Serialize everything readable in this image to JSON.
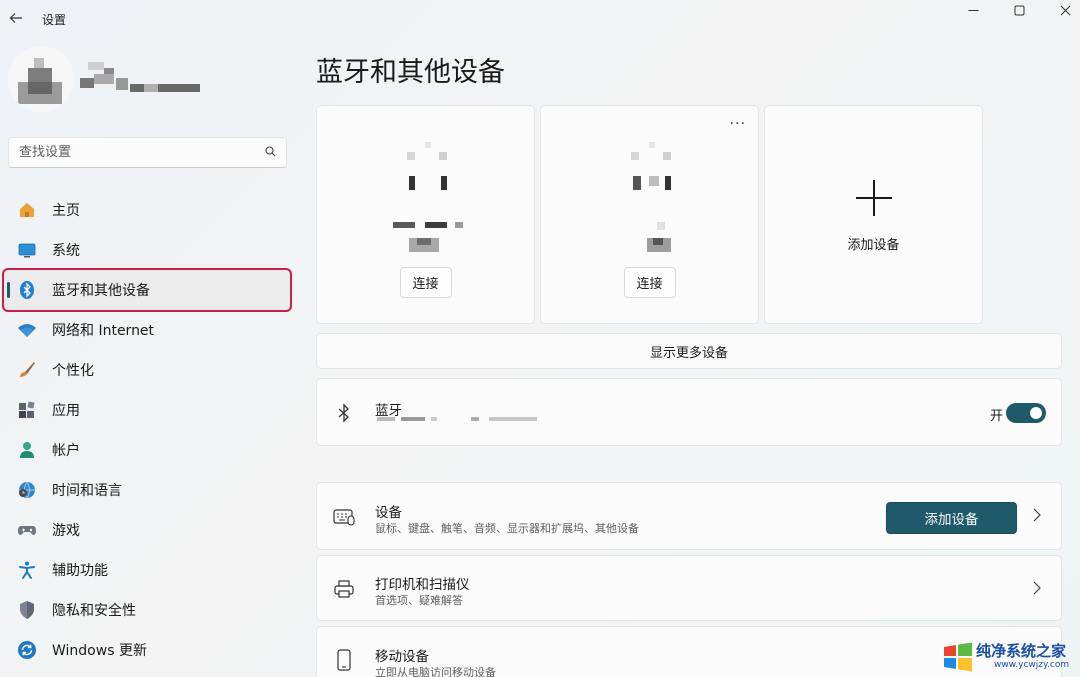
{
  "window": {
    "title": "设置",
    "back_icon": "arrow-left-icon",
    "controls": [
      "minimize-icon",
      "maximize-icon",
      "close-icon"
    ]
  },
  "search": {
    "placeholder": "查找设置",
    "icon": "search-icon"
  },
  "sidebar": {
    "items": [
      {
        "label": "主页",
        "icon": "home-icon",
        "active": false
      },
      {
        "label": "系统",
        "icon": "system-icon",
        "active": false
      },
      {
        "label": "蓝牙和其他设备",
        "icon": "bluetooth-icon",
        "active": true
      },
      {
        "label": "网络和 Internet",
        "icon": "wifi-icon",
        "active": false
      },
      {
        "label": "个性化",
        "icon": "brush-icon",
        "active": false
      },
      {
        "label": "应用",
        "icon": "apps-icon",
        "active": false
      },
      {
        "label": "帐户",
        "icon": "account-icon",
        "active": false
      },
      {
        "label": "时间和语言",
        "icon": "globe-clock-icon",
        "active": false
      },
      {
        "label": "游戏",
        "icon": "gamepad-icon",
        "active": false
      },
      {
        "label": "辅助功能",
        "icon": "accessibility-icon",
        "active": false
      },
      {
        "label": "隐私和安全性",
        "icon": "shield-icon",
        "active": false
      },
      {
        "label": "Windows 更新",
        "icon": "update-icon",
        "active": false
      }
    ]
  },
  "main": {
    "title": "蓝牙和其他设备",
    "device_cards": [
      {
        "button": "连接"
      },
      {
        "button": "连接",
        "more_icon": "more-icon"
      }
    ],
    "add_card": {
      "label": "添加设备",
      "icon": "plus-icon"
    },
    "show_more": "显示更多设备",
    "bluetooth": {
      "title": "蓝牙",
      "icon": "bluetooth-icon",
      "state_label": "开",
      "on": true
    },
    "rows": [
      {
        "title": "设备",
        "subtitle": "鼠标、键盘、触笔、音频、显示器和扩展坞、其他设备",
        "icon": "keyboard-icon",
        "button": "添加设备"
      },
      {
        "title": "打印机和扫描仪",
        "subtitle": "首选项、疑难解答",
        "icon": "printer-icon"
      },
      {
        "title": "移动设备",
        "subtitle": "立即从电脑访问移动设备",
        "icon": "phone-icon"
      }
    ]
  },
  "watermark": {
    "line1": "纯净系统之家",
    "line2": "www.ycwjzy.com",
    "icon": "windows-logo-icon"
  },
  "colors": {
    "accent": "#1f5a6b",
    "highlight_border": "#c3204a",
    "card_bg": "#fbfbfb"
  }
}
